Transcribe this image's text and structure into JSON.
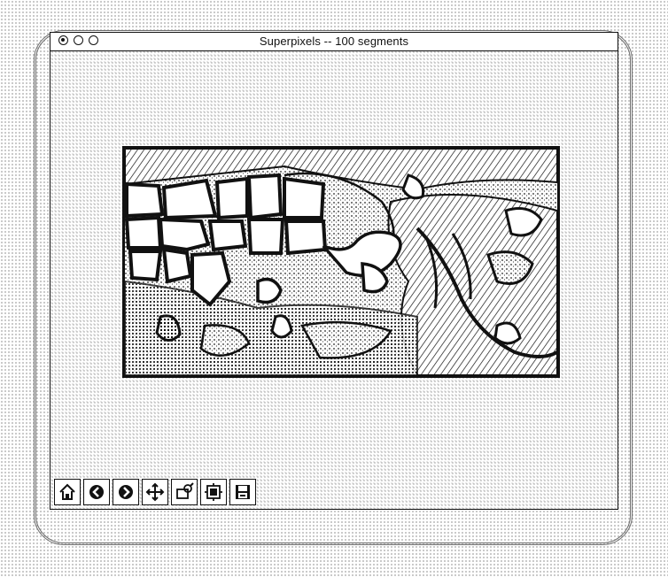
{
  "window": {
    "title": "Superpixels -- 100 segments",
    "controls": [
      "close-button",
      "minimize-button",
      "zoom-button"
    ]
  },
  "figure": {
    "image_content": "superpixel segmentation boundaries overlaid on a photo of a tortoise among foliage"
  },
  "toolbar": {
    "buttons": [
      {
        "icon": "home-icon"
      },
      {
        "icon": "back-arrow-icon"
      },
      {
        "icon": "forward-arrow-icon"
      },
      {
        "icon": "pan-move-icon"
      },
      {
        "icon": "zoom-rect-icon"
      },
      {
        "icon": "subplots-config-icon"
      },
      {
        "icon": "save-floppy-icon"
      }
    ]
  }
}
